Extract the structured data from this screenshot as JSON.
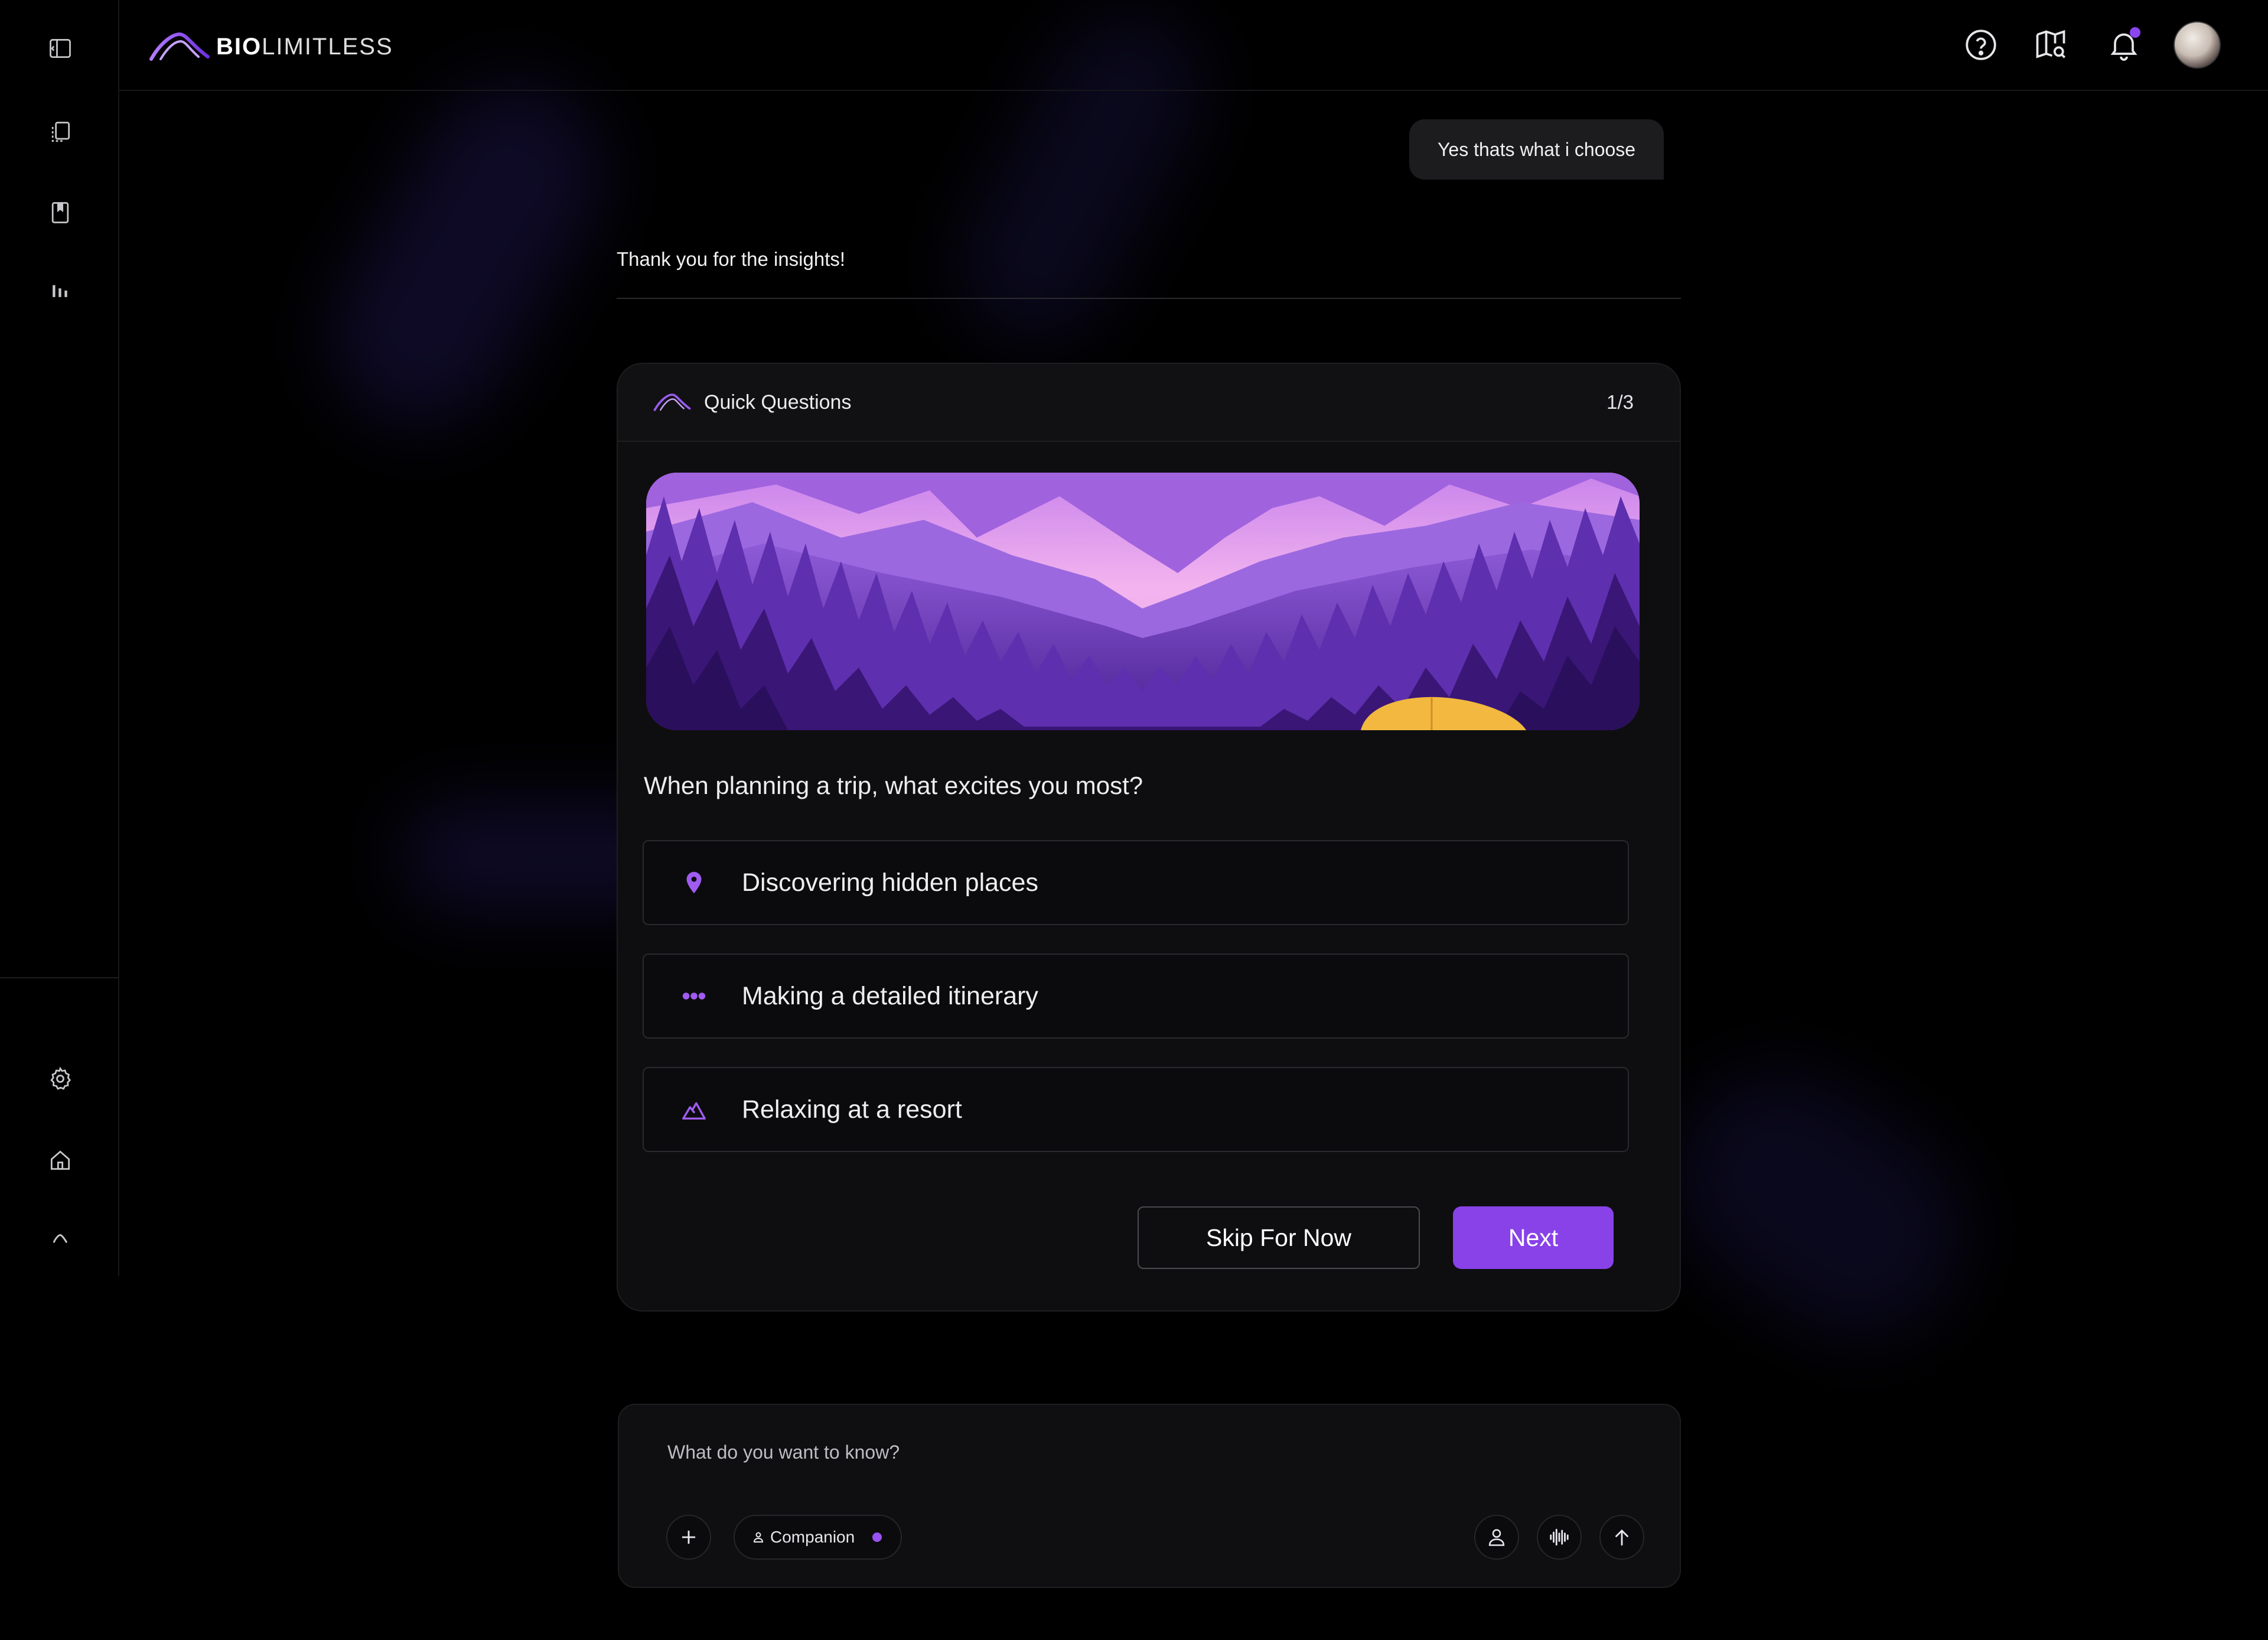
{
  "brand": {
    "bold": "BIO",
    "light": "LIMITLESS"
  },
  "sidebar": {
    "top_items": [
      {
        "icon": "layout-panel-icon"
      },
      {
        "icon": "copy-pages-icon"
      },
      {
        "icon": "bookmark-icon"
      },
      {
        "icon": "bar-chart-icon"
      }
    ],
    "bottom_items": [
      {
        "icon": "settings-gear-icon"
      },
      {
        "icon": "home-icon"
      },
      {
        "icon": "brand-arc-icon"
      }
    ]
  },
  "header_icons": [
    "help-icon",
    "map-search-icon",
    "bell-icon",
    "avatar"
  ],
  "chat": {
    "user_message": "Yes thats what i choose",
    "assistant_message": "Thank you for the insights!"
  },
  "quick_questions": {
    "title": "Quick Questions",
    "progress": "1/3",
    "question": "When planning a trip, what excites you most?",
    "options": [
      {
        "label": "Discovering hidden places",
        "icon": "map-pin-icon"
      },
      {
        "label": "Making a detailed itinerary",
        "icon": "dots-icon"
      },
      {
        "label": "Relaxing at a resort",
        "icon": "mountain-icon"
      }
    ],
    "skip_label": "Skip For Now",
    "next_label": "Next"
  },
  "composer": {
    "placeholder": "What do you want to know?",
    "mode_chip": "Companion"
  },
  "colors": {
    "accent": "#8842e8",
    "background": "#000000",
    "card": "#0e0e10"
  }
}
